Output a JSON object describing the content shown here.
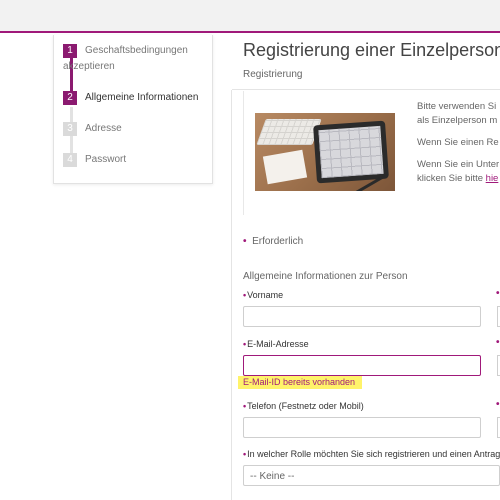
{
  "colors": {
    "accent": "#a0197a",
    "step_active": "#8b1a70",
    "step_inactive": "#dadada",
    "error_highlight": "#fff36a"
  },
  "stepper": {
    "steps": [
      {
        "number": "1",
        "label": "Geschaftsbedingungen akzeptieren",
        "state": "completed"
      },
      {
        "number": "2",
        "label": "Allgemeine Informationen",
        "state": "active"
      },
      {
        "number": "3",
        "label": "Adresse",
        "state": "pending"
      },
      {
        "number": "4",
        "label": "Passwort",
        "state": "pending"
      }
    ]
  },
  "header": {
    "title": "Registrierung einer Einzelperson",
    "subtitle": "Registrierung"
  },
  "info": {
    "lines": [
      "Bitte verwenden Si",
      "als Einzelperson m",
      "Wenn Sie einen Re",
      "Wenn Sie ein Unter",
      "klicken Sie bitte "
    ],
    "link": "hie"
  },
  "form": {
    "required_star": "•",
    "required_note": "Erforderlich",
    "section_heading": "Allgemeine Informationen zur Person",
    "fields": {
      "vorname": {
        "label": "Vorname",
        "value": ""
      },
      "email": {
        "label": "E-Mail-Adresse",
        "value": "",
        "error": "E-Mail-ID bereits vorhanden"
      },
      "telefon": {
        "label": "Telefon (Festnetz oder Mobil)",
        "value": ""
      },
      "rolle": {
        "label": "In welcher Rolle möchten Sie sich registrieren und einen Antrag",
        "selected": "-- Keine --"
      }
    }
  }
}
